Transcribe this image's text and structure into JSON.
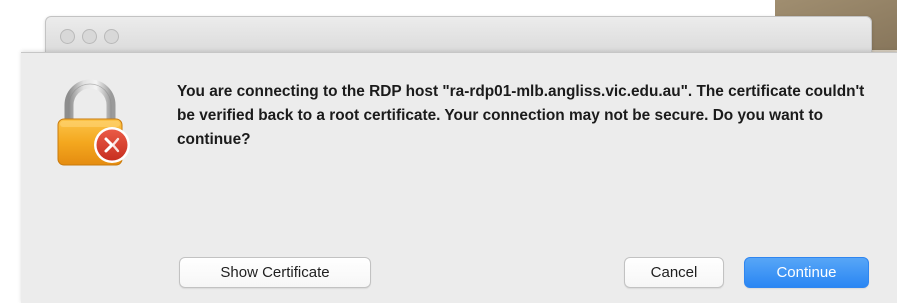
{
  "dialog": {
    "message": "You are connecting to the RDP host \"ra-rdp01-mlb.angliss.vic.edu.au\". The certificate couldn't be verified back to a root certificate. Your connection may not be secure. Do you want to continue?",
    "icon": "lock-icon",
    "badge_icon": "remote-desktop-badge-icon"
  },
  "buttons": {
    "show_certificate": "Show Certificate",
    "cancel": "Cancel",
    "continue": "Continue"
  },
  "colors": {
    "accent": "#2a86f3",
    "lock_body": "#f0a21c",
    "badge": "#d93b2b"
  }
}
